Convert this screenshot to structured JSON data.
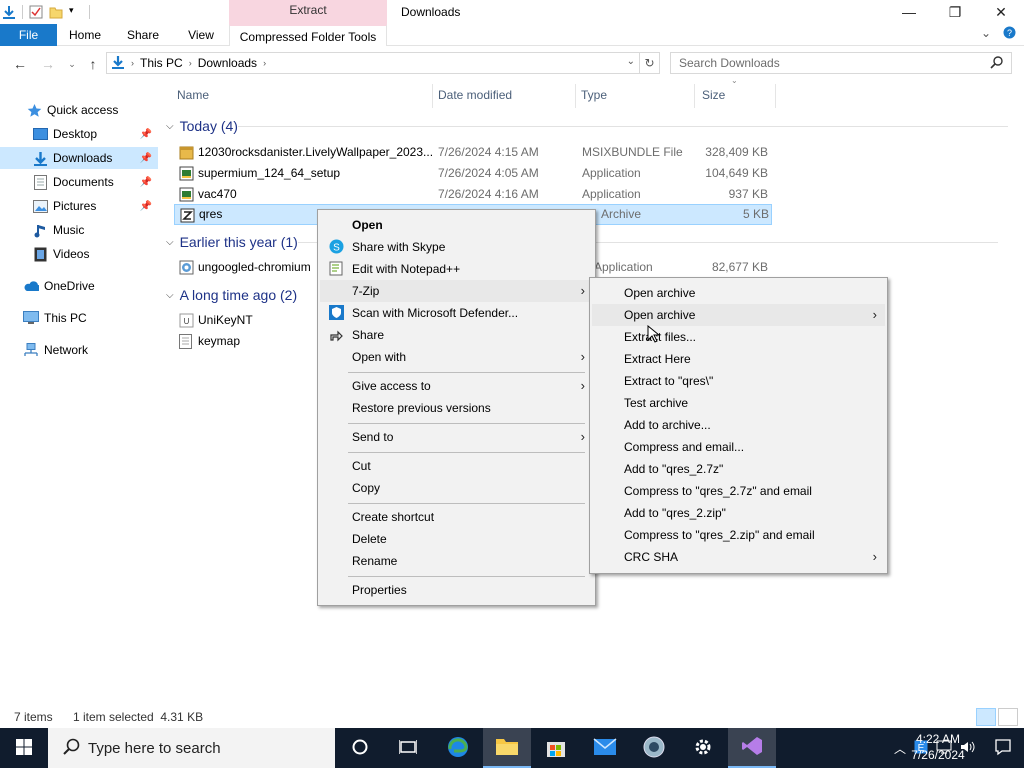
{
  "window": {
    "title": "Downloads",
    "context_tab_group": "Extract",
    "minimize": "—",
    "maximize": "❐",
    "close": "✕"
  },
  "ribbon": {
    "tabs": [
      "File",
      "Home",
      "Share",
      "View",
      "Compressed Folder Tools"
    ],
    "expand_icon": "chevron-down-icon",
    "help_icon": "help-icon"
  },
  "address": {
    "crumbs": [
      "This PC",
      "Downloads"
    ],
    "search_placeholder": "Search Downloads"
  },
  "nav_pane": {
    "items": [
      {
        "label": "Quick access",
        "icon": "star-icon",
        "pinned": false
      },
      {
        "label": "Desktop",
        "icon": "desktop-icon",
        "pinned": true
      },
      {
        "label": "Downloads",
        "icon": "download-icon",
        "pinned": true,
        "selected": true
      },
      {
        "label": "Documents",
        "icon": "document-icon",
        "pinned": true
      },
      {
        "label": "Pictures",
        "icon": "picture-icon",
        "pinned": true
      },
      {
        "label": "Music",
        "icon": "music-icon",
        "pinned": false
      },
      {
        "label": "Videos",
        "icon": "video-icon",
        "pinned": false
      },
      {
        "label": "OneDrive",
        "icon": "cloud-icon",
        "pinned": false
      },
      {
        "label": "This PC",
        "icon": "computer-icon",
        "pinned": false
      },
      {
        "label": "Network",
        "icon": "network-icon",
        "pinned": false
      }
    ]
  },
  "columns": [
    "Name",
    "Date modified",
    "Type",
    "Size"
  ],
  "groups": [
    {
      "label": "Today (4)"
    },
    {
      "label": "Earlier this year (1)"
    },
    {
      "label": "A long time ago (2)"
    }
  ],
  "files": [
    {
      "name": "12030rocksdanister.LivelyWallpaper_2023...",
      "date": "7/26/2024 4:15 AM",
      "type": "MSIXBUNDLE File",
      "size": "328,409 KB"
    },
    {
      "name": "supermium_124_64_setup",
      "date": "7/26/2024 4:05 AM",
      "type": "Application",
      "size": "104,649 KB"
    },
    {
      "name": "vac470",
      "date": "7/26/2024 4:16 AM",
      "type": "Application",
      "size": "937 KB"
    },
    {
      "name": "qres",
      "date": "",
      "type": "Archive",
      "size": "5 KB"
    },
    {
      "name": "ungoogled-chromium",
      "date": "",
      "type": "Application",
      "size": "82,677 KB"
    },
    {
      "name": "UniKeyNT",
      "date": "",
      "type": "",
      "size": ""
    },
    {
      "name": "keymap",
      "date": "",
      "type": "",
      "size": ""
    }
  ],
  "context_menu": {
    "items": [
      "Open",
      "Share with Skype",
      "Edit with Notepad++",
      "7-Zip",
      "Scan with Microsoft Defender...",
      "Share",
      "Open with",
      "Give access to",
      "Restore previous versions",
      "Send to",
      "Cut",
      "Copy",
      "Create shortcut",
      "Delete",
      "Rename",
      "Properties"
    ]
  },
  "submenu_7zip": {
    "items": [
      "Open archive",
      "Open archive",
      "Extract files...",
      "Extract Here",
      "Extract to \"qres\\\"",
      "Test archive",
      "Add to archive...",
      "Compress and email...",
      "Add to \"qres_2.7z\"",
      "Compress to \"qres_2.7z\" and email",
      "Add to \"qres_2.zip\"",
      "Compress to \"qres_2.zip\" and email",
      "CRC SHA"
    ]
  },
  "status": {
    "items": "7 items",
    "selected": "1 item selected  4.31 KB"
  },
  "taskbar": {
    "search_placeholder": "Type here to search",
    "time": "4:22 AM",
    "date": "7/26/2024"
  },
  "colors": {
    "accent": "#1979ca",
    "selection": "#cce8ff",
    "taskbar": "#101c2d",
    "extract_tab": "#f8d6e0"
  }
}
